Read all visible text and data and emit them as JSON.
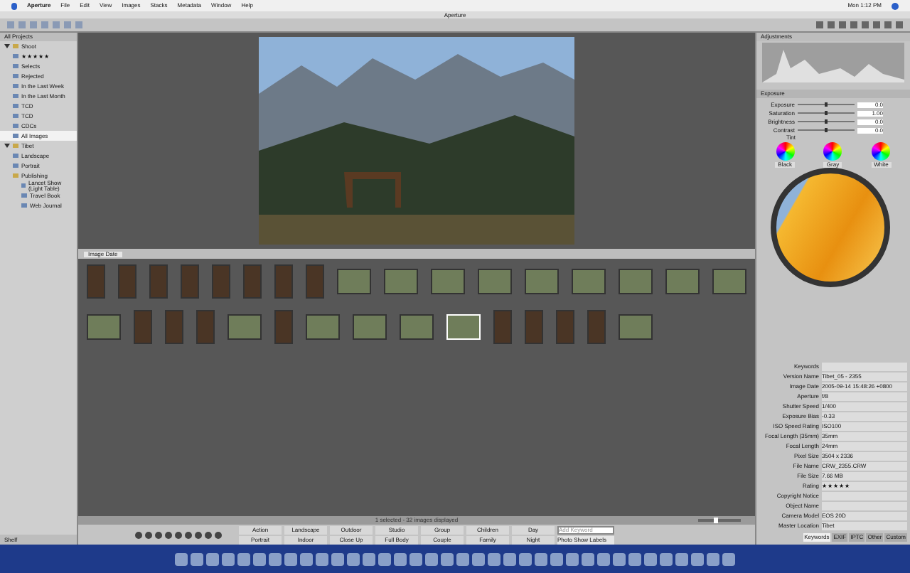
{
  "menu_bar": {
    "items": [
      "Aperture",
      "File",
      "Edit",
      "View",
      "Images",
      "Stacks",
      "Metadata",
      "Window",
      "Help"
    ],
    "clock": "Mon 1:12 PM"
  },
  "window": {
    "title": "Aperture"
  },
  "sidebar": {
    "header": "All Projects",
    "items": [
      {
        "label": "Shoot",
        "expanded": true,
        "selected": false,
        "children": [
          {
            "label": "★★★★★",
            "selected": false
          },
          {
            "label": "Selects",
            "selected": false
          },
          {
            "label": "Rejected",
            "selected": false
          },
          {
            "label": "In the Last Week",
            "selected": false
          },
          {
            "label": "In the Last Month",
            "selected": false
          },
          {
            "label": "TCD",
            "selected": false
          },
          {
            "label": "TCD",
            "selected": false
          },
          {
            "label": "CDCs",
            "selected": false
          },
          {
            "label": "All Images",
            "selected": true
          }
        ]
      },
      {
        "label": "Tibet",
        "expanded": true,
        "selected": false,
        "children": [
          {
            "label": "Landscape",
            "selected": false
          },
          {
            "label": "Portrait",
            "selected": false
          },
          {
            "label": "Publishing",
            "selected": false,
            "children": [
              {
                "label": "Lancet Show (Light Table)",
                "selected": false
              },
              {
                "label": "Travel Book",
                "selected": false
              },
              {
                "label": "Web Journal",
                "selected": false
              }
            ]
          }
        ]
      }
    ],
    "footer": "Shelf"
  },
  "browser": {
    "sort": "Image Date",
    "rows": [
      [
        {
          "kind": "portrait",
          "selected": false
        },
        {
          "kind": "portrait",
          "selected": false
        },
        {
          "kind": "portrait",
          "selected": false
        },
        {
          "kind": "portrait",
          "selected": false
        },
        {
          "kind": "portrait",
          "selected": false
        },
        {
          "kind": "portrait",
          "selected": false
        },
        {
          "kind": "portrait",
          "selected": false
        },
        {
          "kind": "portrait",
          "selected": false
        },
        {
          "kind": "landscape",
          "selected": false
        },
        {
          "kind": "landscape",
          "selected": false
        },
        {
          "kind": "landscape",
          "selected": false
        },
        {
          "kind": "landscape",
          "selected": false
        },
        {
          "kind": "landscape",
          "selected": false
        },
        {
          "kind": "landscape",
          "selected": false
        },
        {
          "kind": "landscape",
          "selected": false
        },
        {
          "kind": "landscape",
          "selected": false
        },
        {
          "kind": "landscape",
          "selected": false
        }
      ],
      [
        {
          "kind": "landscape",
          "selected": false
        },
        {
          "kind": "portrait",
          "selected": false
        },
        {
          "kind": "portrait",
          "selected": false
        },
        {
          "kind": "portrait",
          "selected": false
        },
        {
          "kind": "landscape",
          "selected": false
        },
        {
          "kind": "portrait",
          "selected": false
        },
        {
          "kind": "landscape",
          "selected": false
        },
        {
          "kind": "landscape",
          "selected": false
        },
        {
          "kind": "landscape",
          "selected": false
        },
        {
          "kind": "landscape",
          "selected": true
        },
        {
          "kind": "portrait",
          "selected": false
        },
        {
          "kind": "portrait",
          "selected": false
        },
        {
          "kind": "portrait",
          "selected": false
        },
        {
          "kind": "portrait",
          "selected": false
        },
        {
          "kind": "landscape",
          "selected": false
        }
      ]
    ],
    "status": "1 selected - 32 images displayed",
    "zoom": {
      "level": 0.4
    }
  },
  "keywords": [
    [
      "Action",
      "Landscape",
      "Outdoor",
      "Studio",
      "Group",
      "Children",
      "Day"
    ],
    [
      "Portrait",
      "Indoor",
      "Close Up",
      "Full Body",
      "Couple",
      "Family",
      "Night"
    ]
  ],
  "keyword_field": {
    "placeholder": "Add Keyword"
  },
  "keyword_set": "Photo Show Labels",
  "adjustments": {
    "title": "Adjustments",
    "section": "Exposure",
    "sliders": [
      {
        "label": "Exposure",
        "level": 0.5,
        "value": "0.0"
      },
      {
        "label": "Saturation",
        "level": 0.5,
        "value": "1.00"
      },
      {
        "label": "Brightness",
        "level": 0.5,
        "value": "0.0"
      },
      {
        "label": "Contrast",
        "level": 0.5,
        "value": "0.0"
      }
    ],
    "tint": "Tint",
    "wheels": [
      "Black",
      "Gray",
      "White"
    ]
  },
  "metadata": {
    "fields": [
      {
        "label": "Keywords"
      },
      {
        "label": "Version Name",
        "value": "Tibet_05 - 2355"
      },
      {
        "label": "Image Date",
        "value": "2005-09-14 15:48:26 +0800"
      },
      {
        "label": "Aperture",
        "value": "f/8"
      },
      {
        "label": "Shutter Speed",
        "value": "1/400"
      },
      {
        "label": "Exposure Bias",
        "value": "-0.33"
      },
      {
        "label": "ISO Speed Rating",
        "value": "ISO100"
      },
      {
        "label": "Focal Length (35mm)",
        "value": "35mm"
      },
      {
        "label": "Focal Length",
        "value": "24mm"
      },
      {
        "label": "Pixel Size",
        "value": "3504 x 2336"
      },
      {
        "label": "File Name",
        "value": "CRW_2355.CRW"
      },
      {
        "label": "File Size",
        "value": "7.66 MB"
      },
      {
        "label": "Rating",
        "value": "★★★★★"
      },
      {
        "label": "Copyright Notice"
      },
      {
        "label": "Object Name"
      },
      {
        "label": "Camera Model",
        "value": "EOS 20D"
      },
      {
        "label": "Master Location",
        "value": "Tibet"
      }
    ],
    "tabs": [
      {
        "label": "Keywords",
        "selected": true
      },
      {
        "label": "EXIF",
        "selected": false
      },
      {
        "label": "IPTC",
        "selected": false
      },
      {
        "label": "Other",
        "selected": false
      },
      {
        "label": "Custom",
        "selected": false
      }
    ]
  }
}
